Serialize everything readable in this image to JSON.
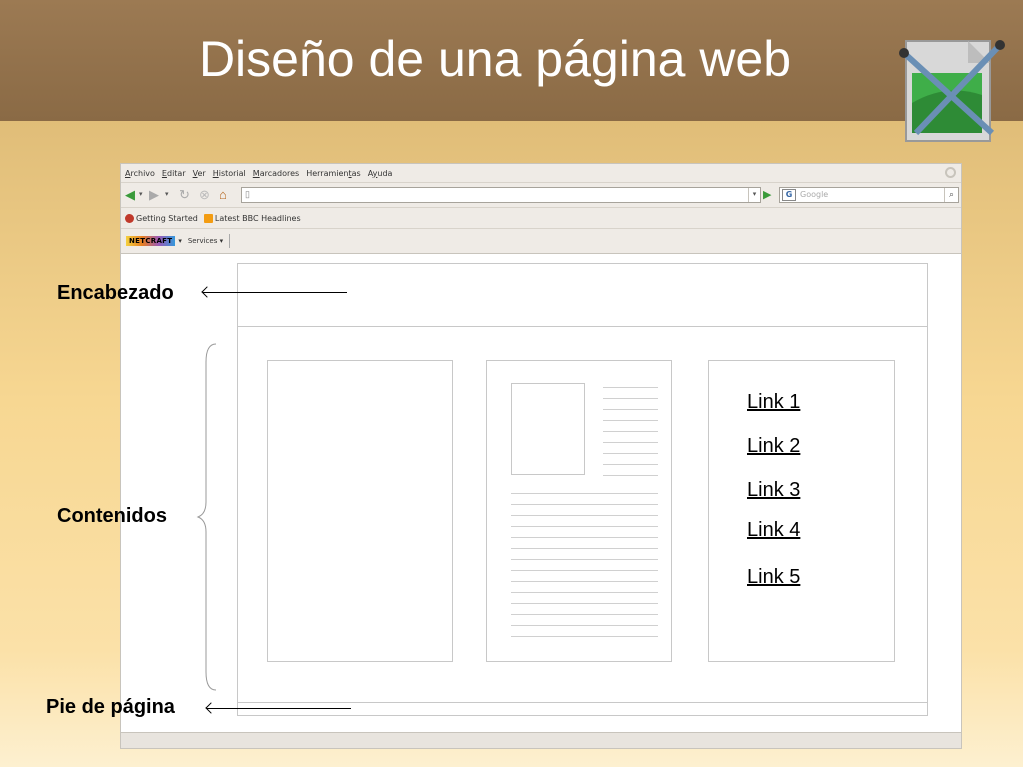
{
  "slide": {
    "title": "Diseño de una página web"
  },
  "browser": {
    "menu": [
      {
        "underline": "A",
        "rest": "rchivo"
      },
      {
        "underline": "E",
        "rest": "ditar"
      },
      {
        "underline": "V",
        "rest": "er"
      },
      {
        "underline": "H",
        "rest": "istorial"
      },
      {
        "underline": "M",
        "rest": "arcadores"
      },
      {
        "pre": "Herramien",
        "underline": "t",
        "rest": "as"
      },
      {
        "pre": "A",
        "underline": "y",
        "rest": "uda"
      }
    ],
    "search_placeholder": "Google",
    "search_engine_letter": "G",
    "bookmarks": [
      "Getting Started",
      "Latest BBC Headlines"
    ],
    "toolbar": {
      "netcraft": "NETCRAFT",
      "services": "Services"
    }
  },
  "wireframe": {
    "labels": {
      "header": "Encabezado",
      "contents": "Contenidos",
      "footer": "Pie de página"
    },
    "links": [
      "Link 1",
      "Link 2",
      "Link 3",
      "Link 4",
      "Link 5"
    ]
  }
}
